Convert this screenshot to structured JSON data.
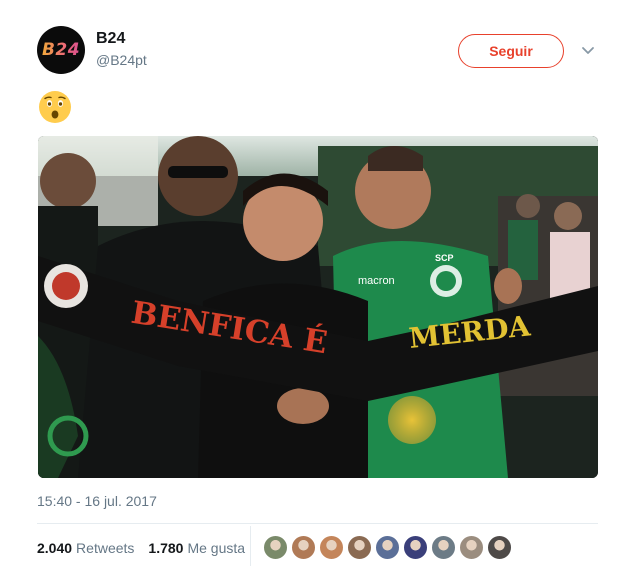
{
  "account": {
    "avatar_text": "B24",
    "name": "B24",
    "handle": "@B24pt"
  },
  "header": {
    "follow_label": "Seguir",
    "menu_icon": "chevron-down-icon"
  },
  "tweet": {
    "emoji": "😯",
    "photo_icon": "photo-image",
    "scarf_text_red": "BENFICA É",
    "scarf_text_yellow": "MERDA",
    "shirt_brand": "macron",
    "crest_text": "SCP",
    "timestamp": "15:40 - 16 jul. 2017"
  },
  "stats": {
    "retweets_count": "2.040",
    "retweets_label": "Retweets",
    "likes_count": "1.780",
    "likes_label": "Me gusta"
  },
  "likers": [
    {
      "name": "liker-avatar-1",
      "color": "#7a8a6a"
    },
    {
      "name": "liker-avatar-2",
      "color": "#b07a56"
    },
    {
      "name": "liker-avatar-3",
      "color": "#c4855a"
    },
    {
      "name": "liker-avatar-4",
      "color": "#8a6a52"
    },
    {
      "name": "liker-avatar-5",
      "color": "#5b6f98"
    },
    {
      "name": "liker-avatar-6",
      "color": "#3a3f7a"
    },
    {
      "name": "liker-avatar-7",
      "color": "#6c7b86"
    },
    {
      "name": "liker-avatar-8",
      "color": "#9b8d7f"
    },
    {
      "name": "liker-avatar-9",
      "color": "#4e4a48"
    }
  ],
  "colors": {
    "accent": "#e8412c",
    "secondary_text": "#657786",
    "scarf_red": "#d6402a",
    "scarf_yellow": "#e2c233",
    "sporting_green": "#1e8a4c"
  }
}
